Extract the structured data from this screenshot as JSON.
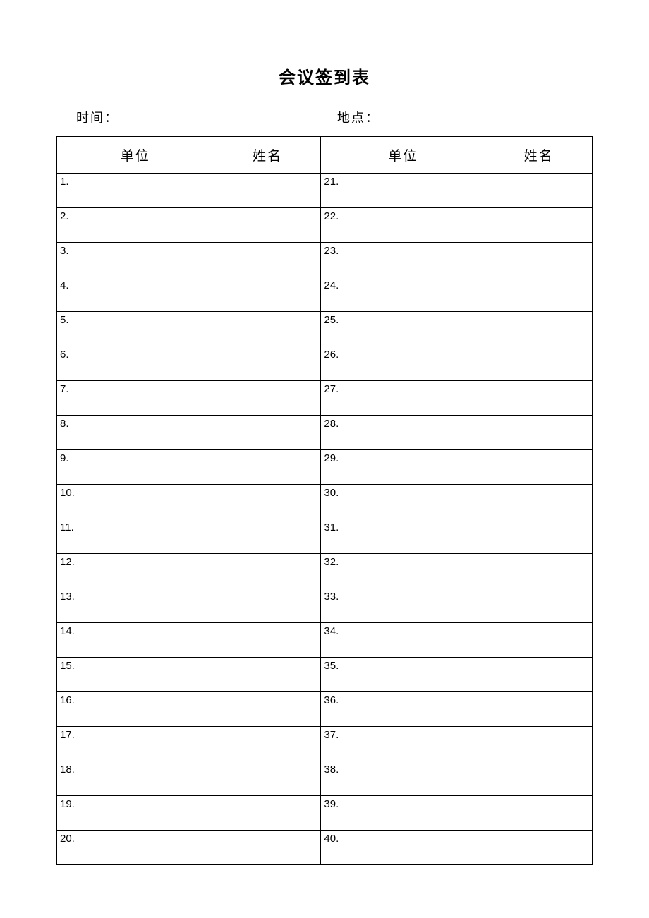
{
  "title": "会议签到表",
  "meta": {
    "time_label": "时间：",
    "location_label": "地点："
  },
  "headers": {
    "unit_left": "单位",
    "name_left": "姓名",
    "unit_right": "单位",
    "name_right": "姓名"
  },
  "rows": [
    {
      "left_num": "1.",
      "left_name": "",
      "right_num": "21.",
      "right_name": ""
    },
    {
      "left_num": "2.",
      "left_name": "",
      "right_num": "22.",
      "right_name": ""
    },
    {
      "left_num": "3.",
      "left_name": "",
      "right_num": "23.",
      "right_name": ""
    },
    {
      "left_num": "4.",
      "left_name": "",
      "right_num": "24.",
      "right_name": ""
    },
    {
      "left_num": "5.",
      "left_name": "",
      "right_num": "25.",
      "right_name": ""
    },
    {
      "left_num": "6.",
      "left_name": "",
      "right_num": "26.",
      "right_name": ""
    },
    {
      "left_num": "7.",
      "left_name": "",
      "right_num": "27.",
      "right_name": ""
    },
    {
      "left_num": "8.",
      "left_name": "",
      "right_num": "28.",
      "right_name": ""
    },
    {
      "left_num": "9.",
      "left_name": "",
      "right_num": "29.",
      "right_name": ""
    },
    {
      "left_num": "10.",
      "left_name": "",
      "right_num": "30.",
      "right_name": ""
    },
    {
      "left_num": "11.",
      "left_name": "",
      "right_num": "31.",
      "right_name": ""
    },
    {
      "left_num": "12.",
      "left_name": "",
      "right_num": "32.",
      "right_name": ""
    },
    {
      "left_num": "13.",
      "left_name": "",
      "right_num": "33.",
      "right_name": ""
    },
    {
      "left_num": "14.",
      "left_name": "",
      "right_num": "34.",
      "right_name": ""
    },
    {
      "left_num": "15.",
      "left_name": "",
      "right_num": "35.",
      "right_name": ""
    },
    {
      "left_num": "16.",
      "left_name": "",
      "right_num": "36.",
      "right_name": ""
    },
    {
      "left_num": "17.",
      "left_name": "",
      "right_num": "37.",
      "right_name": ""
    },
    {
      "left_num": "18.",
      "left_name": "",
      "right_num": "38.",
      "right_name": ""
    },
    {
      "left_num": "19.",
      "left_name": "",
      "right_num": "39.",
      "right_name": ""
    },
    {
      "left_num": "20.",
      "left_name": "",
      "right_num": "40.",
      "right_name": ""
    }
  ]
}
